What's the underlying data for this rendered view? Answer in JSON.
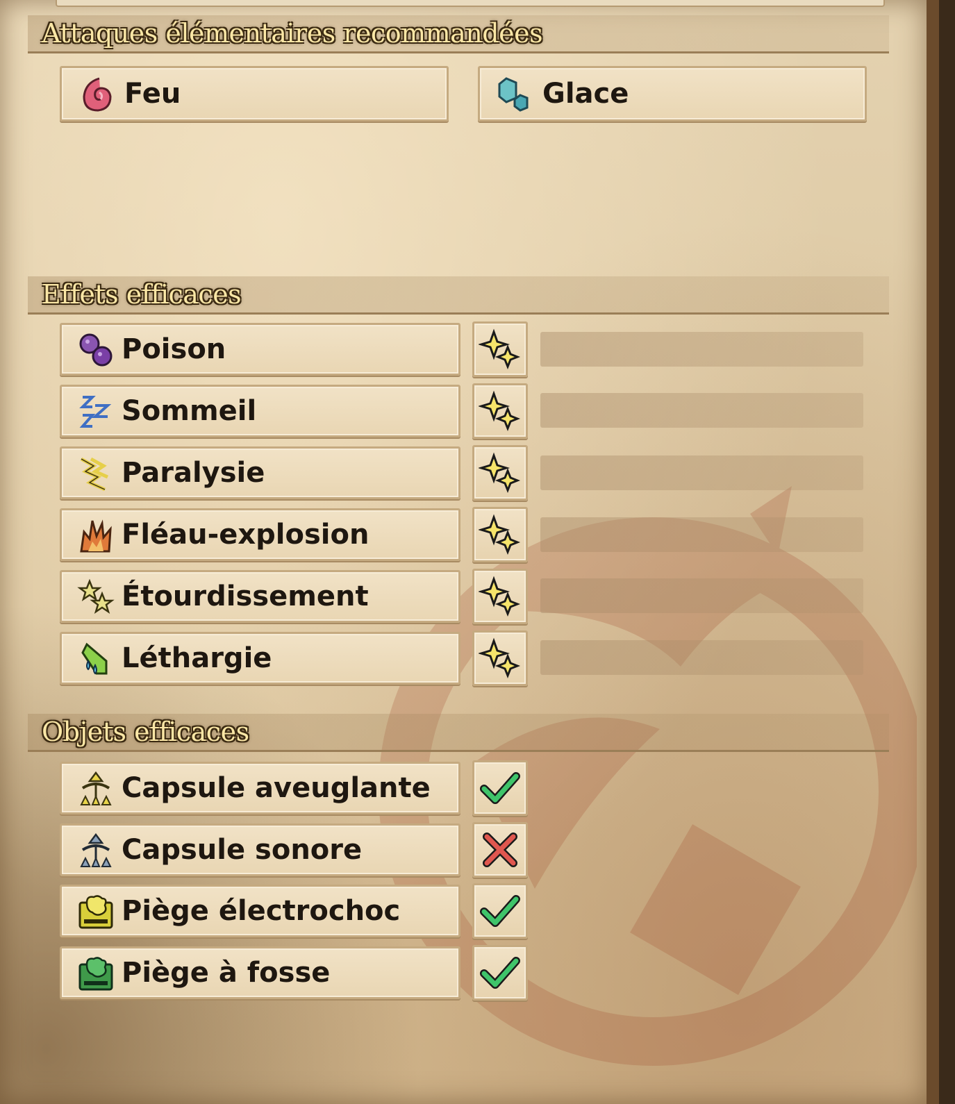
{
  "sections": {
    "elemental": {
      "title": "Attaques élémentaires recommandées",
      "items": [
        {
          "label": "Feu",
          "icon": "fire-icon"
        },
        {
          "label": "Glace",
          "icon": "ice-icon"
        }
      ]
    },
    "effects": {
      "title": "Effets efficaces",
      "items": [
        {
          "label": "Poison",
          "icon": "poison-icon",
          "rating": "sparkle"
        },
        {
          "label": "Sommeil",
          "icon": "sleep-icon",
          "rating": "sparkle"
        },
        {
          "label": "Paralysie",
          "icon": "paralysis-icon",
          "rating": "sparkle"
        },
        {
          "label": "Fléau-explosion",
          "icon": "blast-icon",
          "rating": "sparkle"
        },
        {
          "label": "Étourdissement",
          "icon": "stun-icon",
          "rating": "sparkle"
        },
        {
          "label": "Léthargie",
          "icon": "exhaust-icon",
          "rating": "sparkle"
        }
      ]
    },
    "items": {
      "title": "Objets efficaces",
      "items": [
        {
          "label": "Capsule aveuglante",
          "icon": "flash-pod-icon",
          "effective": true
        },
        {
          "label": "Capsule sonore",
          "icon": "sonic-pod-icon",
          "effective": false
        },
        {
          "label": "Piège électrochoc",
          "icon": "shock-trap-icon",
          "effective": true
        },
        {
          "label": "Piège à fosse",
          "icon": "pitfall-trap-icon",
          "effective": true
        }
      ]
    }
  },
  "colors": {
    "header_text": "#fbe7a6",
    "check": "#3fc46a",
    "cross": "#e0574f",
    "sparkle": "#f6e46a"
  }
}
